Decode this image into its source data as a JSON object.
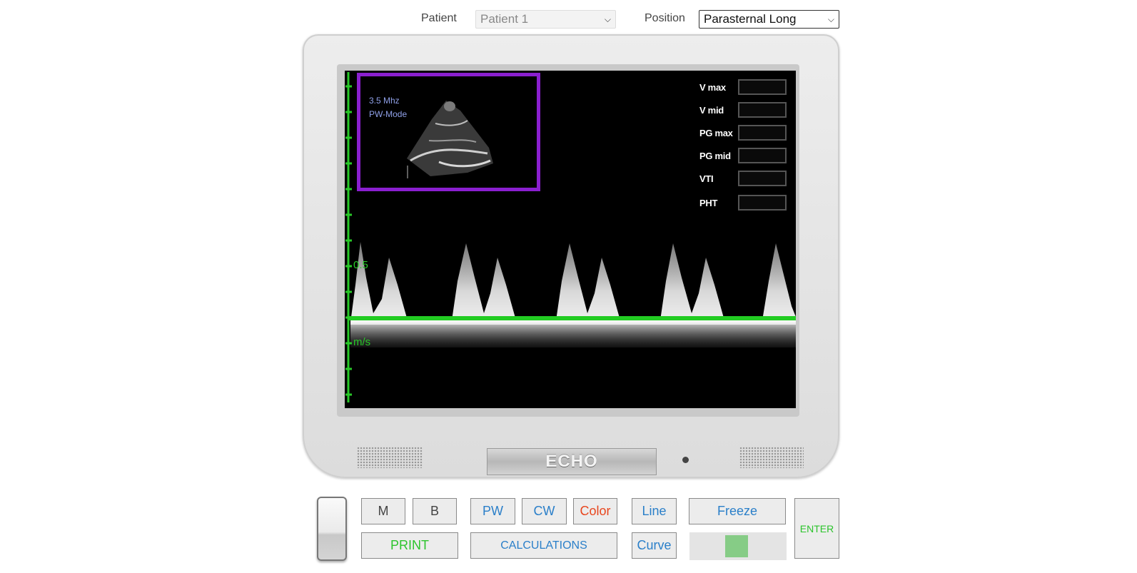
{
  "header": {
    "patient_label": "Patient",
    "patient_value": "Patient 1",
    "position_label": "Position",
    "position_value": "Parasternal Long"
  },
  "screen": {
    "inset": {
      "frequency": "3.5 Mhz",
      "mode": "PW-Mode"
    },
    "measurements": [
      {
        "label": "V max",
        "value": ""
      },
      {
        "label": "V mid",
        "value": ""
      },
      {
        "label": "PG max",
        "value": ""
      },
      {
        "label": "PG mid",
        "value": ""
      },
      {
        "label": "VTI",
        "value": ""
      },
      {
        "label": "PHT",
        "value": ""
      }
    ],
    "axis_value": "0.5",
    "axis_unit": "m/s"
  },
  "monitor": {
    "brand": "ECHO"
  },
  "controls": {
    "m": "M",
    "b": "B",
    "pw": "PW",
    "cw": "CW",
    "color": "Color",
    "line": "Line",
    "freeze": "Freeze",
    "enter": "ENTER",
    "print": "PRINT",
    "calculations": "CALCULATIONS",
    "curve": "Curve"
  },
  "colors": {
    "inset_border": "#8a1fcf",
    "axis_green": "#28c828",
    "button_blue": "#2a7fc9",
    "button_green": "#2cc42c",
    "button_red": "#e8461e"
  }
}
